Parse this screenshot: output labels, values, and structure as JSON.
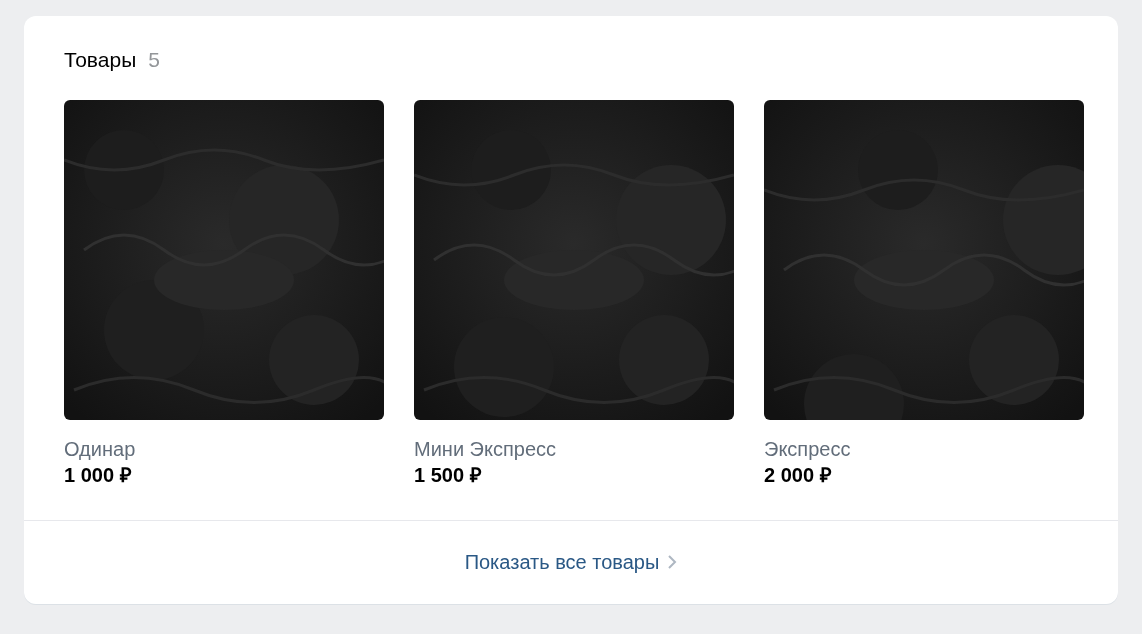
{
  "section": {
    "title": "Товары",
    "count": "5"
  },
  "products": [
    {
      "name": "Одинар",
      "price": "1 000 ₽"
    },
    {
      "name": "Мини Экспресс",
      "price": "1 500 ₽"
    },
    {
      "name": "Экспресс",
      "price": "2 000 ₽"
    }
  ],
  "show_all_link": "Показать все товары"
}
